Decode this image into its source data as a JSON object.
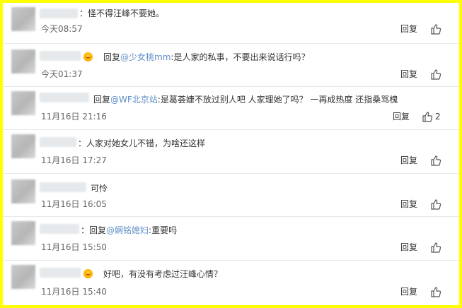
{
  "reply_label": "回复",
  "comments": [
    {
      "reply_to": "",
      "text": "：怪不得汪峰不要她。",
      "time": "今天08:57",
      "likes": ""
    },
    {
      "reply_to": "@少女桃mm",
      "text": ":是人家的私事，不要出来说话行吗？",
      "time": "今天01:37",
      "likes": ""
    },
    {
      "reply_to": "@WF北京站",
      "text": ":是葛荟婕不放过别人吧 人家理她了吗？ 一再成热度 还指桑骂槐",
      "time": "11月16日 21:16",
      "likes": "2"
    },
    {
      "reply_to": "",
      "text": "：人家对她女儿不错，为啥还这样",
      "time": "11月16日 17:27",
      "likes": ""
    },
    {
      "reply_to": "",
      "text": "可怜",
      "time": "11月16日 16:05",
      "likes": ""
    },
    {
      "reply_to": "@娴铭媳妇",
      "text": ":重要吗",
      "time": "11月16日 15:50",
      "likes": ""
    },
    {
      "reply_to": "",
      "text": "好吧，有没有考虑过汪峰心情？",
      "time": "11月16日 15:40",
      "likes": ""
    }
  ]
}
